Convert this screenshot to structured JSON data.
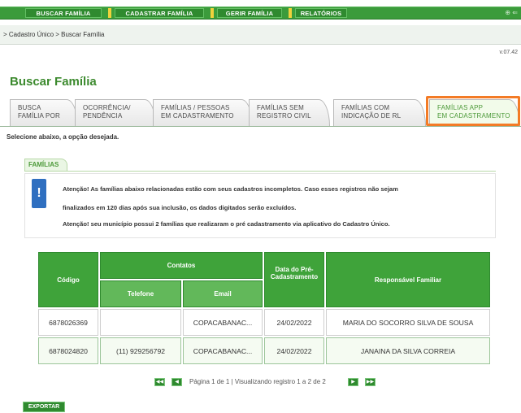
{
  "nav": {
    "items": [
      "BUSCAR FAMÍLIA",
      "CADASTRAR FAMÍLIA",
      "GERIR FAMÍLIA",
      "RELATÓRIOS"
    ],
    "right_glyph": "⊕ ⇐"
  },
  "breadcrumb": "> Cadastro Único > Buscar Família",
  "version": "v.07.42",
  "page_title": "Buscar Família",
  "tabs": [
    {
      "line1": "BUSCA",
      "line2": "FAMÍLIA POR"
    },
    {
      "line1": "OCORRÊNCIA/",
      "line2": "PENDÊNCIA"
    },
    {
      "line1": "FAMÍLIAS / PESSOAS",
      "line2": "EM CADASTRAMENTO"
    },
    {
      "line1": "FAMÍLIAS SEM",
      "line2": "REGISTRO CIVIL"
    },
    {
      "line1": "FAMÍLIAS COM",
      "line2": "INDICAÇÃO DE RL"
    },
    {
      "line1": "FAMÍLIAS APP",
      "line2": "EM CADASTRAMENTO"
    }
  ],
  "instruction": "Selecione abaixo, a opção desejada.",
  "subtab": "FAMÍLIAS",
  "alert": {
    "icon": "!",
    "line1": "Atenção! As famílias abaixo relacionadas estão com seus cadastros incompletos. Caso esses registros não sejam",
    "line2": "finalizados em 120 dias após sua inclusão, os dados digitados serão excluídos.",
    "line3": "Atenção! seu município possui 2 famílias que realizaram o pré cadastramento via aplicativo do Cadastro Único."
  },
  "table": {
    "headers": {
      "codigo": "Código",
      "contatos": "Contatos",
      "telefone": "Telefone",
      "email": "Email",
      "data": "Data do Pré-Cadastramento",
      "responsavel": "Responsável Familiar"
    },
    "rows": [
      {
        "codigo": "6878026369",
        "telefone": "",
        "email": "COPACABANAC...",
        "data": "24/02/2022",
        "responsavel": "MARIA DO SOCORRO SILVA DE SOUSA"
      },
      {
        "codigo": "6878024820",
        "telefone": "(11) 929256792",
        "email": "COPACABANAC...",
        "data": "24/02/2022",
        "responsavel": "JANAINA DA SILVA CORREIA"
      }
    ]
  },
  "pager": {
    "first": "◀◀",
    "prev": "◀",
    "next": "▶",
    "last": "▶▶",
    "text": "Página 1 de 1 | Visualizando registro 1 a 2 de 2"
  },
  "export_label": "EXPORTAR",
  "colors": {
    "brand_green": "#3fa33a",
    "title_green": "#3c8a2e",
    "highlight": "#f37b26",
    "alert_blue": "#2f6fc0"
  }
}
